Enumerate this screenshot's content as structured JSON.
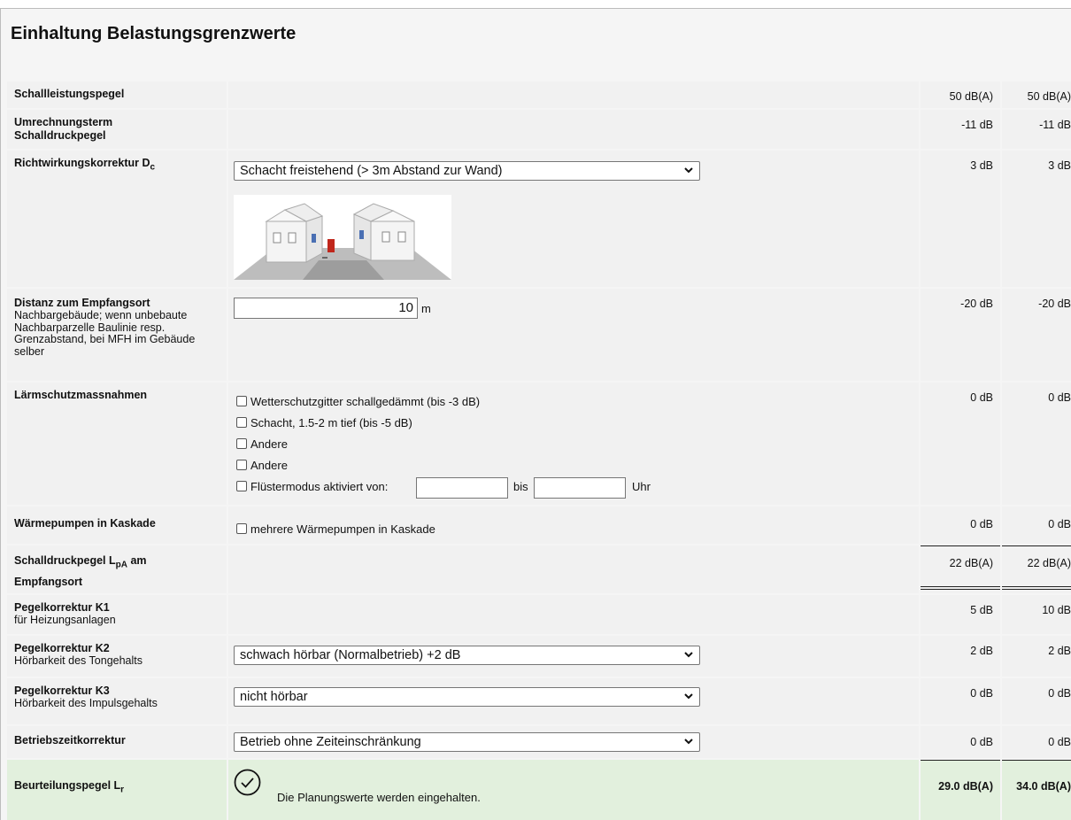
{
  "title": "Einhaltung Belastungsgrenzwerte",
  "rows": {
    "schallleistung": {
      "label": "Schallleistungspegel",
      "v1": "50 dB(A)",
      "v2": "50 dB(A)"
    },
    "umrechnung": {
      "label": "Umrechnungsterm Schalldruckpegel",
      "v1": "-11 dB",
      "v2": "-11 dB"
    },
    "richtwirkung": {
      "label": "Richtwirkungskorrektur D",
      "label_sub": "c",
      "select": "Schacht freistehend (> 3m Abstand zur Wand)",
      "v1": "3 dB",
      "v2": "3 dB"
    },
    "distanz": {
      "label": "Distanz zum Empfangsort",
      "sub": "Nachbargebäude; wenn unbebaute Nachbarparzelle Baulinie resp. Grenzabstand, bei MFH im Gebäude selber",
      "value": "10",
      "unit": "m",
      "v1": "-20 dB",
      "v2": "-20 dB"
    },
    "laermschutz": {
      "label": "Lärmschutzmassnahmen",
      "options": [
        "Wetterschutzgitter schallgedämmt (bis -3 dB)",
        "Schacht, 1.5-2 m tief (bis -5 dB)",
        "Andere",
        "Andere"
      ],
      "fluester": "Flüstermodus aktiviert von:",
      "bis": "bis",
      "uhr": "Uhr",
      "v1": "0 dB",
      "v2": "0 dB"
    },
    "kaskade": {
      "label": "Wärmepumpen in Kaskade",
      "option": "mehrere Wärmepumpen in Kaskade",
      "v1": "0 dB",
      "v2": "0 dB"
    },
    "schalldruck": {
      "label_a": "Schalldruckpegel L",
      "label_sub": "pA",
      "label_b": " am",
      "label_c": "Empfangsort",
      "v1": "22 dB(A)",
      "v2": "22 dB(A)"
    },
    "k1": {
      "label": "Pegelkorrektur K1",
      "sub": "für Heizungsanlagen",
      "v1": "5 dB",
      "v2": "10 dB"
    },
    "k2": {
      "label": "Pegelkorrektur K2",
      "sub": "Hörbarkeit des Tongehalts",
      "select": "schwach hörbar (Normalbetrieb) +2 dB",
      "v1": "2 dB",
      "v2": "2 dB"
    },
    "k3": {
      "label": "Pegelkorrektur K3",
      "sub": "Hörbarkeit des Impulsgehalts",
      "select": "nicht hörbar",
      "v1": "0 dB",
      "v2": "0 dB"
    },
    "betrieb": {
      "label": "Betriebszeitkorrektur",
      "select": "Betrieb ohne Zeiteinschränkung",
      "v1": "0 dB",
      "v2": "0 dB"
    },
    "beurteilung": {
      "label": "Beurteilungspegel L",
      "label_sub": "r",
      "message": "Die Planungswerte werden eingehalten.",
      "v1": "29.0 dB(A)",
      "v2": "34.0 dB(A)"
    }
  },
  "icons": {
    "select_arrow": "chevron-down-icon",
    "result": "checkmark-circle-icon",
    "illustration": "houses-illustration"
  },
  "colors": {
    "row_bg": "#f1f1f1",
    "result_bg": "#e2f0dd"
  }
}
